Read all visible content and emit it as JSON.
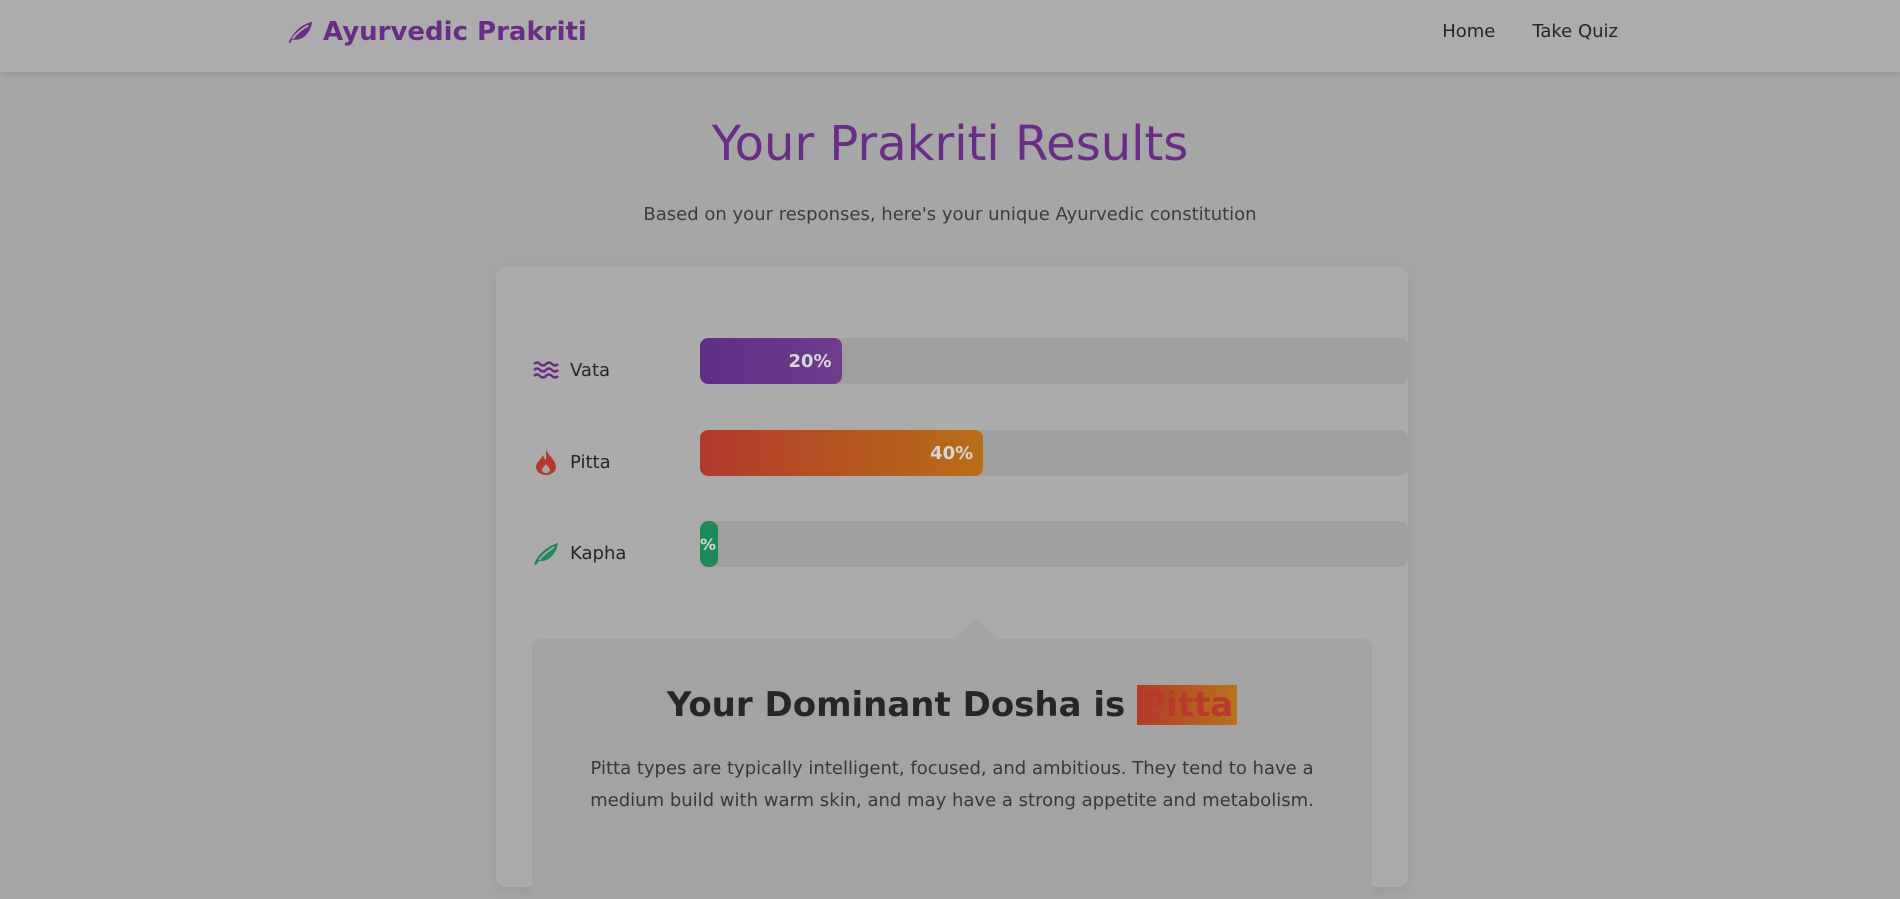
{
  "header": {
    "brand": "Ayurvedic Prakriti",
    "nav": [
      {
        "label": "Home"
      },
      {
        "label": "Take Quiz"
      }
    ]
  },
  "main": {
    "title": "Your Prakriti Results",
    "subtitle": "Based on your responses, here's your unique Ayurvedic constitution"
  },
  "doshas": [
    {
      "name": "Vata",
      "percent": 20,
      "percent_label": "20%",
      "icon": "wind-waves-icon",
      "color": "#5f2d82"
    },
    {
      "name": "Pitta",
      "percent": 40,
      "percent_label": "40%",
      "icon": "fire-drop-icon",
      "color": "#b13a2c"
    },
    {
      "name": "Kapha",
      "percent": 2.6,
      "percent_label": "%",
      "icon": "leaf-icon",
      "color": "#1f8a58"
    }
  ],
  "result": {
    "heading_prefix": "Your Dominant Dosha is",
    "dominant": "Pitta",
    "description": "Pitta types are typically intelligent, focused, and ambitious. They tend to have a medium build with warm skin, and may have a strong appetite and metabolism."
  },
  "colors": {
    "brand": "#6a2d86",
    "vata": "#5f2d82",
    "pitta": "#b13a2c",
    "kapha": "#1f8a58"
  }
}
